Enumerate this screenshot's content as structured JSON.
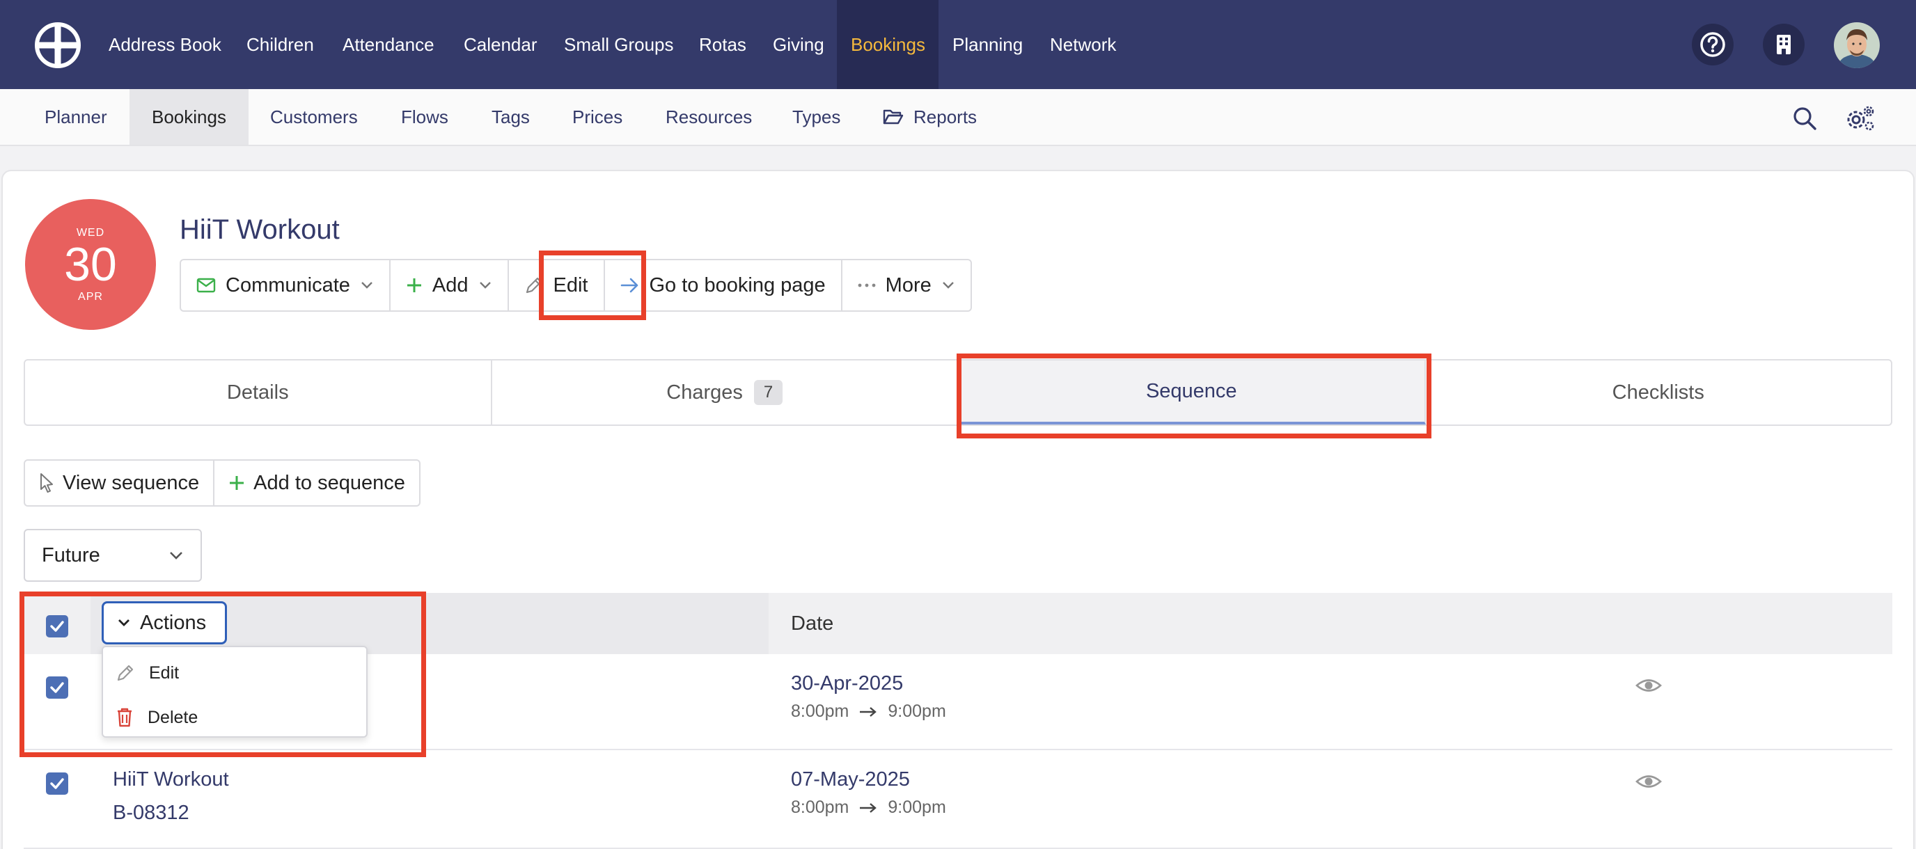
{
  "topnav": {
    "items": [
      {
        "label": "Address Book"
      },
      {
        "label": "Children"
      },
      {
        "label": "Attendance"
      },
      {
        "label": "Calendar"
      },
      {
        "label": "Small Groups"
      },
      {
        "label": "Rotas"
      },
      {
        "label": "Giving"
      },
      {
        "label": "Bookings",
        "active": true
      },
      {
        "label": "Planning"
      },
      {
        "label": "Network"
      }
    ],
    "icons": [
      "help-icon",
      "building-icon"
    ],
    "colors": {
      "bar": "#343a6a",
      "active_bg": "#272b54",
      "active_text": "#f5b93d"
    }
  },
  "subnav": {
    "items": [
      {
        "label": "Planner"
      },
      {
        "label": "Bookings",
        "active": true
      },
      {
        "label": "Customers"
      },
      {
        "label": "Flows"
      },
      {
        "label": "Tags"
      },
      {
        "label": "Prices"
      },
      {
        "label": "Resources"
      },
      {
        "label": "Types"
      },
      {
        "label": "Reports",
        "icon": "folder-open-icon"
      }
    ],
    "icons": [
      "search-icon",
      "settings-icon"
    ]
  },
  "booking": {
    "date": {
      "weekday": "WED",
      "day": "30",
      "month": "APR"
    },
    "title": "HiiT Workout",
    "badge_color": "#e8605e"
  },
  "toolbar": {
    "communicate": "Communicate",
    "add": "Add",
    "edit": "Edit",
    "goto": "Go to booking page",
    "more": "More"
  },
  "tabs": [
    {
      "label": "Details"
    },
    {
      "label": "Charges",
      "count": "7"
    },
    {
      "label": "Sequence",
      "active": true
    },
    {
      "label": "Checklists"
    }
  ],
  "sequence": {
    "view_label": "View sequence",
    "add_label": "Add to sequence",
    "filter_value": "Future"
  },
  "table": {
    "actions_label": "Actions",
    "date_header": "Date",
    "rows": [
      {
        "title": "",
        "ref": "",
        "date": "30-Apr-2025",
        "start": "8:00pm",
        "end": "9:00pm",
        "checked": true
      },
      {
        "title": "HiiT Workout",
        "ref": "B-08312",
        "date": "07-May-2025",
        "start": "8:00pm",
        "end": "9:00pm",
        "checked": true
      }
    ]
  },
  "actions_menu": {
    "edit": "Edit",
    "delete": "Delete"
  },
  "highlight_color": "#e8402a"
}
